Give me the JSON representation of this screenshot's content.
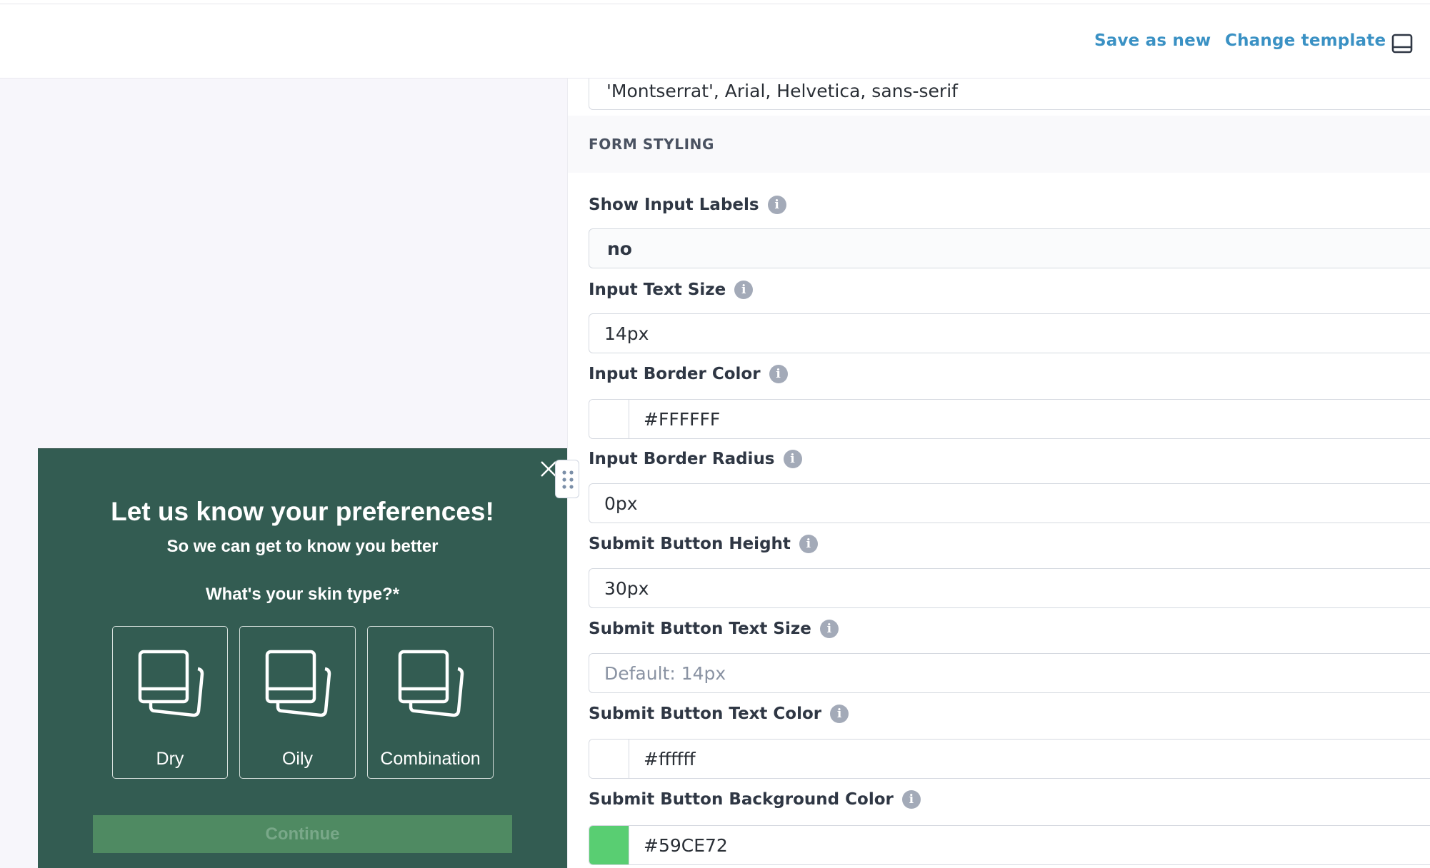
{
  "topbar": {
    "save_as_new": "Save as new",
    "change_template": "Change template",
    "panel_toggle_icon": "panel-toggle-icon"
  },
  "settings": {
    "font_family_value": "'Montserrat', Arial, Helvetica, sans-serif",
    "section_title": "FORM STYLING",
    "fields": {
      "show_input_labels": {
        "label": "Show Input Labels",
        "value": "no"
      },
      "input_text_size": {
        "label": "Input Text Size",
        "value": "14px"
      },
      "input_border_color": {
        "label": "Input Border Color",
        "value": "#FFFFFF",
        "swatch": "#ffffff"
      },
      "input_border_radius": {
        "label": "Input Border Radius",
        "value": "0px"
      },
      "submit_button_height": {
        "label": "Submit Button Height",
        "value": "30px"
      },
      "submit_button_text_size": {
        "label": "Submit Button Text Size",
        "placeholder": "Default: 14px"
      },
      "submit_button_text_color": {
        "label": "Submit Button Text Color",
        "value": "#ffffff",
        "swatch": "#ffffff"
      },
      "submit_button_bg_color": {
        "label": "Submit Button Background Color",
        "value": "#59CE72",
        "swatch": "#59ce72"
      }
    },
    "info_icon_glyph": "i"
  },
  "popup": {
    "title": "Let us know your preferences!",
    "subtitle": "So we can get to know you better",
    "question": "What's your skin type?*",
    "options": [
      {
        "label": "Dry",
        "icon": "image-placeholder-icon"
      },
      {
        "label": "Oily",
        "icon": "image-placeholder-icon"
      },
      {
        "label": "Combination",
        "icon": "image-placeholder-icon"
      }
    ],
    "continue_label": "Continue",
    "background_color": "#335c52"
  }
}
